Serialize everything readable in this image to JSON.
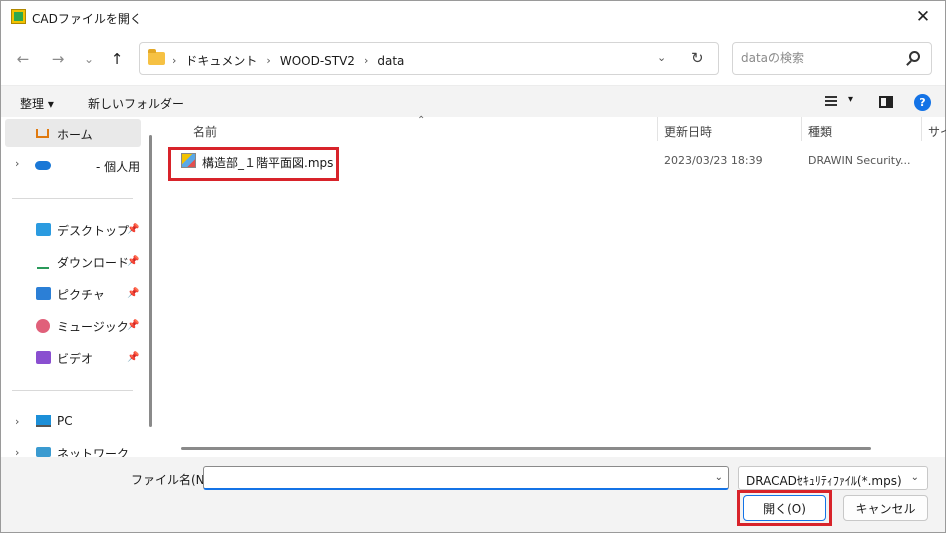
{
  "window": {
    "title": "CADファイルを開く",
    "close_glyph": "✕"
  },
  "nav": {
    "back_glyph": "←",
    "forward_glyph": "→",
    "history_glyph": "⌄",
    "up_glyph": "↑"
  },
  "address": {
    "crumbs": [
      "ドキュメント",
      "WOOD-STV2",
      "data"
    ],
    "sep": "›",
    "dropdown_glyph": "⌄",
    "refresh_glyph": "↻"
  },
  "search": {
    "placeholder": "dataの検索"
  },
  "toolbar": {
    "organize": "整理 ▾",
    "new_folder": "新しいフォルダー",
    "view_drop_glyph": "▾",
    "help": "?"
  },
  "sidebar": {
    "home": "ホーム",
    "personal": "- 個人用",
    "desktop": "デスクトップ",
    "downloads": "ダウンロード",
    "pictures": "ピクチャ",
    "music": "ミュージック",
    "videos": "ビデオ",
    "pc": "PC",
    "network": "ネットワーク",
    "chevron": "›",
    "pin": "📌"
  },
  "columns": {
    "name": "名前",
    "modified": "更新日時",
    "type": "種類",
    "size": "サイ",
    "sort_glyph": "⌃"
  },
  "files": [
    {
      "name": "構造部_１階平面図.mps",
      "modified": "2023/03/23 18:39",
      "type": "DRAWIN Security..."
    }
  ],
  "bottom": {
    "filename_label": "ファイル名(N):",
    "filename_value": "",
    "filetype": "DRACADｾｷｭﾘﾃｨﾌｧｲﾙ(*.mps)",
    "drop_glyph": "⌄",
    "open_button": "開く(O)",
    "cancel_button": "キャンセル"
  },
  "colors": {
    "highlight": "#d8232a",
    "accent": "#1473e6",
    "toolbar_bg": "#f3f3f3"
  }
}
